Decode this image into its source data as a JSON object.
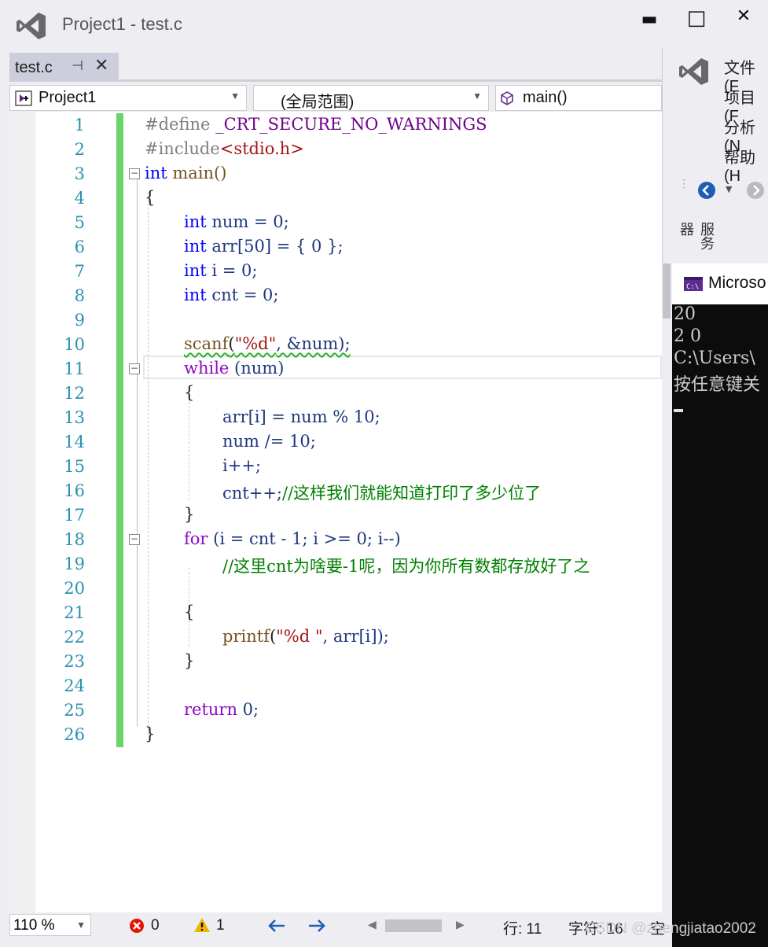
{
  "window": {
    "title": "Project1 - test.c",
    "minimize": "▬",
    "maximize": "□",
    "close": "✕"
  },
  "tab": {
    "label": "test.c",
    "pin": "⊣",
    "close": "✕"
  },
  "nav": {
    "project": "Project1",
    "scope": "(全局范围)",
    "member": "main()"
  },
  "code": {
    "line_numbers": [
      "1",
      "2",
      "3",
      "4",
      "5",
      "6",
      "7",
      "8",
      "9",
      "10",
      "11",
      "12",
      "13",
      "14",
      "15",
      "16",
      "17",
      "18",
      "19",
      "20",
      "21",
      "22",
      "23",
      "24",
      "25",
      "26"
    ],
    "l1_pp": "#define ",
    "l1_mac": "_CRT_SECURE_NO_WARNINGS",
    "l2_pp": "#include",
    "l2_str": "<stdio.h>",
    "l3_kw": "int",
    "l3_rest": " main()",
    "l4": "{",
    "l5_kw": "int",
    "l5_rest": " num = 0;",
    "l6_kw": "int",
    "l6_rest": " arr[50] = { 0 };",
    "l7_kw": "int",
    "l7_rest": " i = 0;",
    "l8_kw": "int",
    "l8_rest": " cnt = 0;",
    "l10_fn": "scanf",
    "l10_a": "(",
    "l10_str": "\"%d\"",
    "l10_b": ", &num);",
    "l11_kw": "while",
    "l11_rest": " (num)",
    "l12": "{",
    "l13": "arr[i] = num % 10;",
    "l14": "num /= 10;",
    "l15": "i++;",
    "l16_code": "cnt++;",
    "l16_cm": "//这样我们就能知道打印了多少位了",
    "l17": "}",
    "l18_kw": "for",
    "l18_rest": " (i = cnt - 1; i >= 0; i--)",
    "l19_cm": "//这里cnt为啥要-1呢，因为你所有数都存放好了之",
    "l21": "{",
    "l22_fn": "printf",
    "l22_a": "(",
    "l22_str": "\"%d \"",
    "l22_b": ", arr[i]);",
    "l23": "}",
    "l25_kw": "return",
    "l25_rest": " 0;",
    "l26": "}"
  },
  "status": {
    "zoom": "110 %",
    "errors": "0",
    "warnings": "1",
    "line": "行: 11",
    "char": "字符: 16",
    "extra": "空"
  },
  "side": {
    "menu": [
      "文件(F",
      "项目(F",
      "分析(N",
      "帮助(H"
    ],
    "vertical_label": "服务器"
  },
  "console": {
    "title": "Microso",
    "lines": [
      "20",
      "2 0",
      "C:\\Users\\",
      "按任意键关"
    ]
  },
  "watermark": "CSDN @zhengjiatao2002",
  "colors": {
    "change_bar": "#6ad36a",
    "keyword": "#0000ff",
    "comment": "#008000",
    "string": "#a31515",
    "line_number": "#2b91af"
  }
}
